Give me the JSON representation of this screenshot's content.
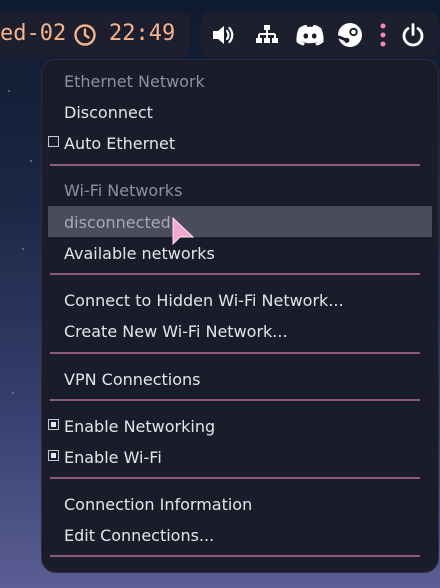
{
  "topbar": {
    "date": "ed-02",
    "time": "22:49",
    "accent_color": "#f5b48d",
    "icons": [
      "clock-icon",
      "volume-icon",
      "network-icon",
      "discord-icon",
      "steam-icon",
      "more-icon",
      "power-icon"
    ]
  },
  "menu": {
    "ethernet": {
      "header": "Ethernet Network",
      "disconnect": "Disconnect",
      "auto_ethernet": "Auto Ethernet"
    },
    "wifi": {
      "header": "Wi-Fi Networks",
      "status": "disconnected",
      "available": "Available networks"
    },
    "hidden_network": "Connect to Hidden Wi-Fi Network...",
    "create_network": "Create New Wi-Fi Network...",
    "vpn": "VPN Connections",
    "enable_networking": "Enable Networking",
    "enable_wifi": "Enable Wi-Fi",
    "connection_info": "Connection Information",
    "edit_connections": "Edit Connections...",
    "separator_color": "#8e5a7a",
    "highlight_color": "#4a4b5c"
  }
}
